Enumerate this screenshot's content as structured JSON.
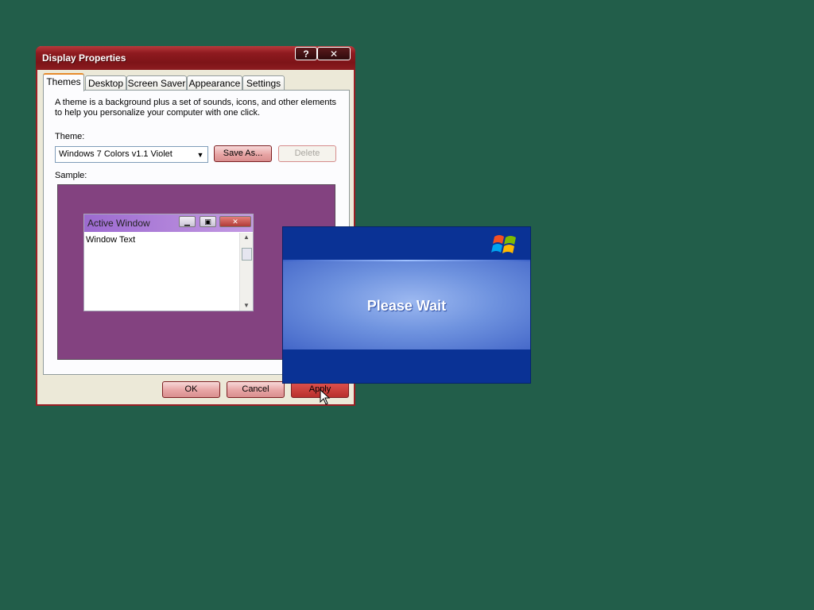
{
  "window": {
    "title": "Display Properties",
    "help_label": "?",
    "close_label": "✕"
  },
  "tabs": [
    {
      "label": "Themes"
    },
    {
      "label": "Desktop"
    },
    {
      "label": "Screen Saver"
    },
    {
      "label": "Appearance"
    },
    {
      "label": "Settings"
    }
  ],
  "themes": {
    "description": "A theme is a background plus a set of sounds, icons, and other elements to help you personalize your computer with one click.",
    "theme_label": "Theme:",
    "theme_value": "Windows 7 Colors v1.1 Violet",
    "save_as_label": "Save As...",
    "delete_label": "Delete",
    "sample_label": "Sample:"
  },
  "sample": {
    "window_title": "Active Window",
    "window_text": "Window Text",
    "background_color": "#834280"
  },
  "footer": {
    "ok_label": "OK",
    "cancel_label": "Cancel",
    "apply_label": "Apply"
  },
  "wait_dialog": {
    "message": "Please Wait"
  },
  "colors": {
    "desktop": "#225e4a",
    "title_bar": "#8e1a1f",
    "wait_blue": "#0a3295"
  }
}
